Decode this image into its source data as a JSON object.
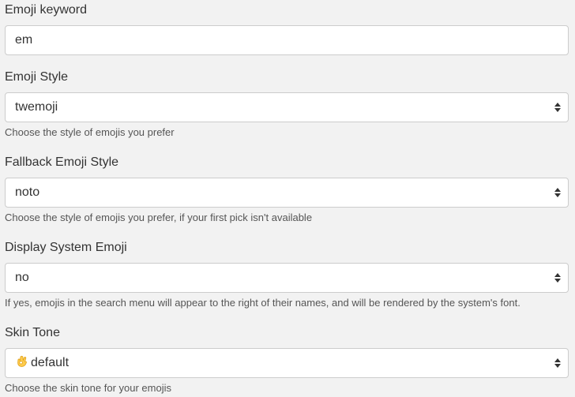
{
  "emoji_keyword": {
    "label": "Emoji keyword",
    "value": "em"
  },
  "emoji_style": {
    "label": "Emoji Style",
    "selected": "twemoji",
    "hint": "Choose the style of emojis you prefer"
  },
  "fallback_emoji_style": {
    "label": "Fallback Emoji Style",
    "selected": "noto",
    "hint": "Choose the style of emojis you prefer, if your first pick isn't available"
  },
  "display_system_emoji": {
    "label": "Display System Emoji",
    "selected": "no",
    "hint": "If yes, emojis in the search menu will appear to the right of their names, and will be rendered by the system's font."
  },
  "skin_tone": {
    "label": "Skin Tone",
    "selected": "default",
    "selected_icon": "ok-hand-emoji-icon",
    "hint": "Choose the skin tone for your emojis"
  }
}
